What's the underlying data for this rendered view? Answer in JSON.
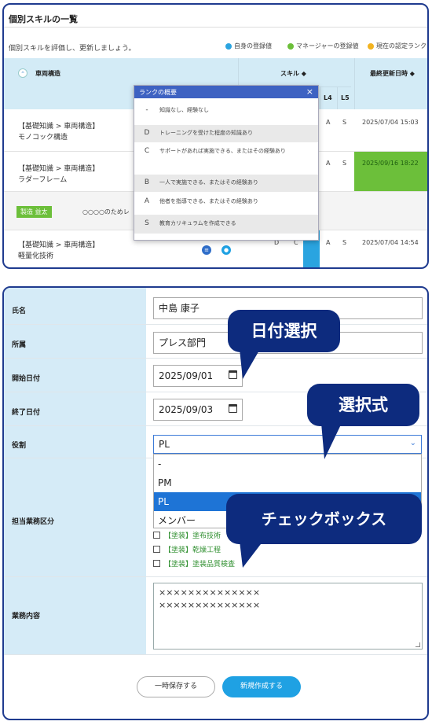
{
  "skill_list": {
    "title": "個別スキルの一覧",
    "subtitle": "個別スキルを評価し、更新しましょう。",
    "legend": [
      {
        "label": "自身の登録値",
        "color": "#2aa4e0"
      },
      {
        "label": "マネージャーの登録値",
        "color": "#6cbf3a"
      },
      {
        "label": "現在の認定ランク",
        "color": "#f2b320"
      }
    ],
    "header": {
      "category": "車両構造",
      "skill": "スキル ◆",
      "last_updated": "最終更新日時 ◆",
      "l4": "L4",
      "l5": "L5"
    },
    "rows": [
      {
        "line1": "【基礎知識 > 車両構造】",
        "line2": "モノコック構造",
        "l4": "A",
        "l5": "S",
        "date": "2025/07/04 15:03"
      },
      {
        "line1": "【基礎知識 > 車両構造】",
        "line2": "ラダーフレーム",
        "l4": "A",
        "l5": "S",
        "date": "2025/09/16 18:22"
      },
      {
        "line1": "【基礎知識 > 車両構造】",
        "line2": "軽量化技術",
        "l4": "A",
        "l5": "S",
        "date": "2025/07/04 14:54"
      }
    ],
    "comment": {
      "tag": "製造 益太",
      "text": "○○○○のためレ"
    },
    "row3_partial_cells": [
      "D",
      "C"
    ],
    "popup": {
      "title": "ランクの概要",
      "close": "×",
      "ranks": [
        {
          "key": "-",
          "desc": "知識なし、経験なし"
        },
        {
          "key": "D",
          "desc": "トレーニングを受けた程度の知識あり"
        },
        {
          "key": "C",
          "desc": "サポートがあれば実施できる、またはその経験あり"
        },
        {
          "key": "B",
          "desc": "一人で実施できる、またはその経験あり"
        },
        {
          "key": "A",
          "desc": "他者を指導できる、またはその経験あり"
        },
        {
          "key": "S",
          "desc": "教育カリキュラムを作成できる"
        }
      ]
    }
  },
  "form": {
    "labels": {
      "name": "氏名",
      "dept": "所属",
      "start": "開始日付",
      "end": "終了日付",
      "role": "役割",
      "area": "担当業務区分",
      "content": "業務内容"
    },
    "values": {
      "name": "中島 康子",
      "dept": "プレス部門",
      "start": "2025/09/01",
      "end": "2025/09/03",
      "role": "PL"
    },
    "role_options": [
      "-",
      "PM",
      "PL",
      "メンバー"
    ],
    "selected_role": "PL",
    "checkboxes": [
      "【塗装】塗布技術",
      "【塗装】乾燥工程",
      "【塗装】塗装品質検査"
    ],
    "content_text": [
      "××××××××××××××",
      "××××××××××××××"
    ],
    "buttons": {
      "save": "一時保存する",
      "create": "新規作成する"
    }
  },
  "callouts": {
    "date": "日付選択",
    "select": "選択式",
    "checkbox": "チェックボックス"
  }
}
